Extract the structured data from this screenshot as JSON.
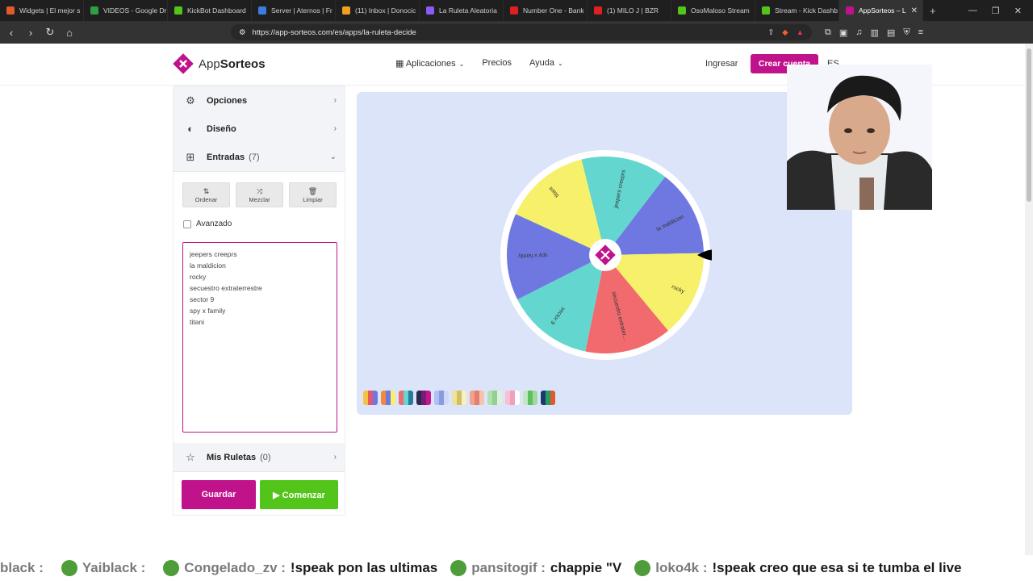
{
  "browser": {
    "tabs": [
      {
        "label": "Widgets | El mejor s",
        "color": "#e05a2b"
      },
      {
        "label": "VIDEOS - Google Dr",
        "color": "#2f9e44"
      },
      {
        "label": "KickBot Dashboard",
        "color": "#52c41a"
      },
      {
        "label": "Server | Aternos | Fr",
        "color": "#3b7ddd"
      },
      {
        "label": "(11) Inbox | Donocic",
        "color": "#f0a020"
      },
      {
        "label": "La Ruleta Aleatoria",
        "color": "#8a5cf6"
      },
      {
        "label": "Number One - Bank",
        "color": "#e02020"
      },
      {
        "label": "(1) MILO J | BZR",
        "color": "#e02020"
      },
      {
        "label": "OsoMaloso Stream",
        "color": "#52c41a"
      },
      {
        "label": "Stream - Kick Dashb",
        "color": "#52c41a"
      },
      {
        "label": "AppSorteos – L",
        "color": "#c0128a"
      }
    ],
    "url": "https://app-sorteos.com/es/apps/la-ruleta-decide"
  },
  "header": {
    "brand_light": "App",
    "brand_bold": "Sorteos",
    "nav": [
      "Aplicaciones",
      "Precios",
      "Ayuda"
    ],
    "login": "Ingresar",
    "signup": "Crear cuenta",
    "lang": "ES"
  },
  "panel": {
    "opciones": "Opciones",
    "diseno": "Diseño",
    "entradas": "Entradas",
    "entradas_count": "(7)",
    "ordenar": "Ordenar",
    "mezclar": "Mezclar",
    "limpiar": "Limpiar",
    "avanzado": "Avanzado",
    "entries": [
      "jeepers creeprs",
      "la maldicion",
      "rocky",
      "secuestro extraterrestre",
      "sector 9",
      "spy x family",
      "titani"
    ],
    "mis_ruletas": "Mis Ruletas",
    "mis_ruletas_count": "(0)",
    "guardar": "Guardar",
    "comenzar": "Comenzar"
  },
  "wheel": {
    "segments": [
      {
        "label": "jeepers creeprs",
        "color": "#63d6d0"
      },
      {
        "label": "la maldicion",
        "color": "#6f78e0"
      },
      {
        "label": "rocky",
        "color": "#f6f06a"
      },
      {
        "label": "secuestro extrater...",
        "color": "#f06a6e"
      },
      {
        "label": "sector 9",
        "color": "#63d6d0"
      },
      {
        "label": "spy x family",
        "color": "#6f78e0"
      },
      {
        "label": "titani",
        "color": "#f6f06a"
      }
    ]
  },
  "ticker": [
    {
      "user": "black :",
      "msg": ""
    },
    {
      "user": "Yaiblack :",
      "msg": ""
    },
    {
      "user": "Congelado_zv :",
      "msg": "!speak pon las ultimas"
    },
    {
      "user": "pansitogif :",
      "msg": "chappie \"V"
    },
    {
      "user": "loko4k :",
      "msg": "!speak creo que esa si te tumba el live"
    }
  ]
}
